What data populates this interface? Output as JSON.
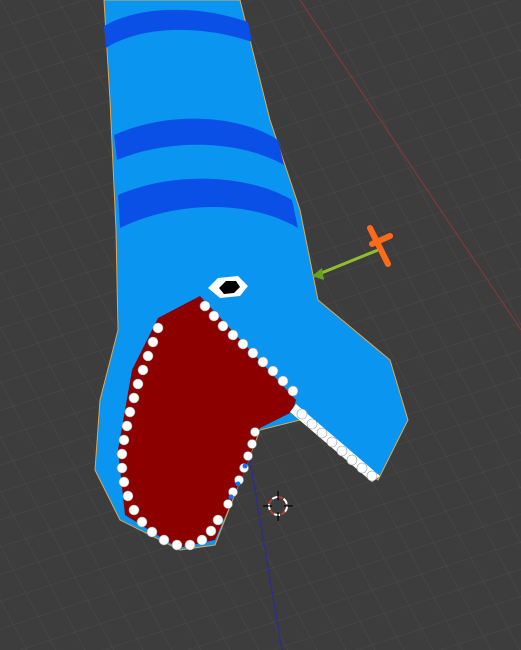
{
  "viewport": {
    "background": "#3d3d3d",
    "grid_color": "#4a4a4a",
    "x_axis_color": "#8a3a3a",
    "z_axis_color": "#2a2a8a"
  },
  "object": {
    "name": "snake",
    "body_color": "#0a96f0",
    "stripe_color": "#0a50e6",
    "mouth_color": "#8c0000",
    "teeth_color": "#ffffff",
    "eye_white": "#ffffff",
    "eye_pupil": "#000000",
    "selection_outline": "#e6a64a"
  },
  "gizmo": {
    "handle_color": "#ff6a1a",
    "shaft_color": "#8fbf2a"
  },
  "cursor_3d": {
    "icon": "3d-cursor-icon"
  }
}
